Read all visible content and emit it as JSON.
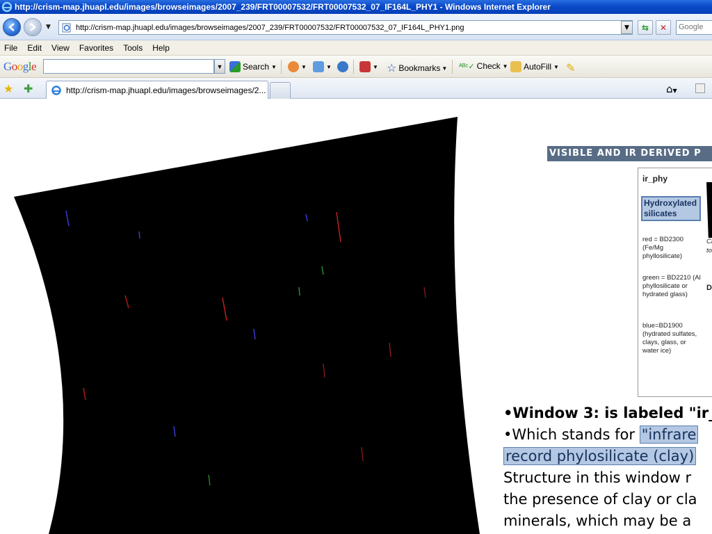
{
  "window": {
    "title": "http://crism-map.jhuapl.edu/images/browseimages/2007_239/FRT00007532/FRT00007532_07_IF164L_PHY1 - Windows Internet Explorer"
  },
  "address": {
    "url": "http://crism-map.jhuapl.edu/images/browseimages/2007_239/FRT00007532/FRT00007532_07_IF164L_PHY1.png",
    "search_placeholder": "Google"
  },
  "menu": {
    "items": [
      "File",
      "Edit",
      "View",
      "Favorites",
      "Tools",
      "Help"
    ]
  },
  "google_toolbar": {
    "logo": "Google",
    "search_label": "Search",
    "bookmarks_label": "Bookmarks",
    "check_label": "Check",
    "autofill_label": "AutoFill"
  },
  "tabs": {
    "active_label": "http://crism-map.jhuapl.edu/images/browseimages/2..."
  },
  "slide": {
    "header": "VISIBLE AND IR DERIVED P",
    "legend_title": "ir_phy",
    "legend_highlight": "Hydroxylated silicates",
    "legend_red": "red = BD2300 (Fe/Mg phyllosilicate)",
    "legend_green": "green = BD2210 (Al phyllosilicate or hydrated glass)",
    "legend_blue": "blue=BD1900 (hydrated sulfates, clays, glass, or water ice)",
    "legend_right_1": "Cl",
    "legend_right_2": "to",
    "legend_right_3": "Do",
    "bullet_1": "•Window 3: is labeled \"ir_",
    "bullet_2_prefix": "•Which stands for ",
    "bullet_2_highlight": "\"infrare",
    "bullet_3_highlight": "record phylosilicate (clay)",
    "line_4": "Structure in this window r",
    "line_5": "the presence of clay or cla",
    "line_6": "minerals, which may be a"
  },
  "colors": {
    "title_bar": "#0a49c8",
    "slide_header": "#586c86",
    "highlight_fill": "#b4c8e3",
    "highlight_border": "#5a7eb0"
  }
}
